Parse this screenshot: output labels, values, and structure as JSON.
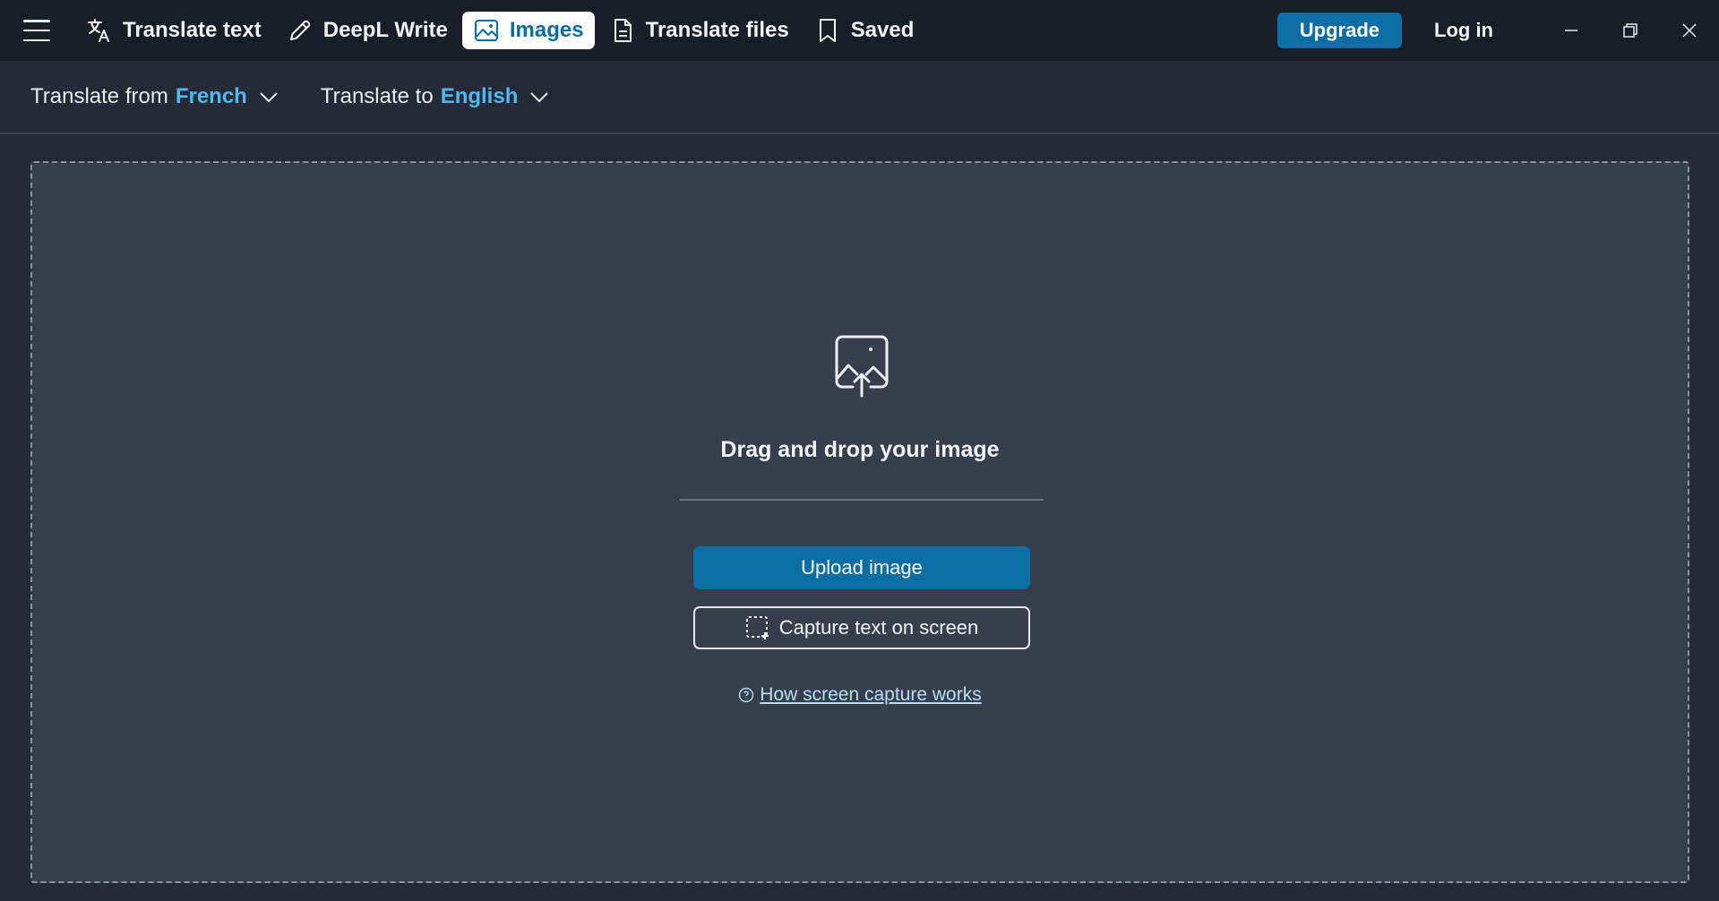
{
  "nav": {
    "tabs": [
      {
        "label": "Translate text",
        "icon": "translate-icon"
      },
      {
        "label": "DeepL Write",
        "icon": "pencil-icon"
      },
      {
        "label": "Images",
        "icon": "image-icon",
        "active": true
      },
      {
        "label": "Translate files",
        "icon": "file-icon"
      },
      {
        "label": "Saved",
        "icon": "bookmark-icon"
      }
    ],
    "upgrade_label": "Upgrade",
    "login_label": "Log in"
  },
  "languages": {
    "from_label": "Translate from",
    "from_value": "French",
    "to_label": "Translate to",
    "to_value": "English"
  },
  "dropzone": {
    "title": "Drag and drop your image",
    "upload_label": "Upload image",
    "capture_label": "Capture text on screen",
    "help_link": "How screen capture works"
  },
  "colors": {
    "accent": "#0b6fa5",
    "language_highlight": "#4fb8f0",
    "titlebar_bg": "#1a1f27",
    "panel_bg": "#383f4c"
  }
}
